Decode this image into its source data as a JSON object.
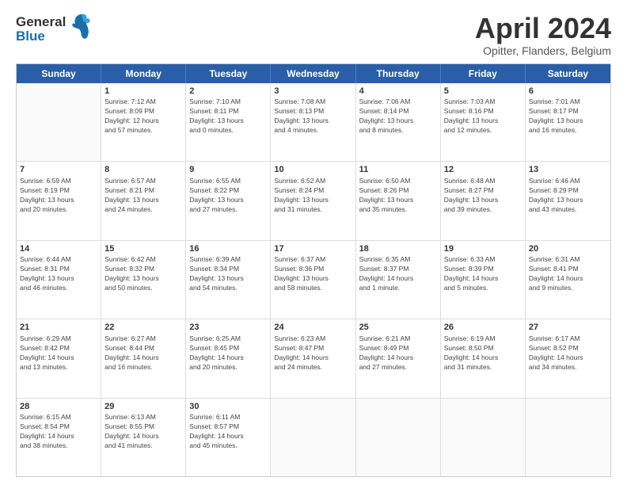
{
  "header": {
    "logo_general": "General",
    "logo_blue": "Blue",
    "month_title": "April 2024",
    "subtitle": "Opitter, Flanders, Belgium"
  },
  "weekdays": [
    "Sunday",
    "Monday",
    "Tuesday",
    "Wednesday",
    "Thursday",
    "Friday",
    "Saturday"
  ],
  "rows": [
    [
      {
        "day": "",
        "text": ""
      },
      {
        "day": "1",
        "text": "Sunrise: 7:12 AM\nSunset: 8:09 PM\nDaylight: 12 hours\nand 57 minutes."
      },
      {
        "day": "2",
        "text": "Sunrise: 7:10 AM\nSunset: 8:11 PM\nDaylight: 13 hours\nand 0 minutes."
      },
      {
        "day": "3",
        "text": "Sunrise: 7:08 AM\nSunset: 8:13 PM\nDaylight: 13 hours\nand 4 minutes."
      },
      {
        "day": "4",
        "text": "Sunrise: 7:06 AM\nSunset: 8:14 PM\nDaylight: 13 hours\nand 8 minutes."
      },
      {
        "day": "5",
        "text": "Sunrise: 7:03 AM\nSunset: 8:16 PM\nDaylight: 13 hours\nand 12 minutes."
      },
      {
        "day": "6",
        "text": "Sunrise: 7:01 AM\nSunset: 8:17 PM\nDaylight: 13 hours\nand 16 minutes."
      }
    ],
    [
      {
        "day": "7",
        "text": "Sunrise: 6:59 AM\nSunset: 8:19 PM\nDaylight: 13 hours\nand 20 minutes."
      },
      {
        "day": "8",
        "text": "Sunrise: 6:57 AM\nSunset: 8:21 PM\nDaylight: 13 hours\nand 24 minutes."
      },
      {
        "day": "9",
        "text": "Sunrise: 6:55 AM\nSunset: 8:22 PM\nDaylight: 13 hours\nand 27 minutes."
      },
      {
        "day": "10",
        "text": "Sunrise: 6:52 AM\nSunset: 8:24 PM\nDaylight: 13 hours\nand 31 minutes."
      },
      {
        "day": "11",
        "text": "Sunrise: 6:50 AM\nSunset: 8:26 PM\nDaylight: 13 hours\nand 35 minutes."
      },
      {
        "day": "12",
        "text": "Sunrise: 6:48 AM\nSunset: 8:27 PM\nDaylight: 13 hours\nand 39 minutes."
      },
      {
        "day": "13",
        "text": "Sunrise: 6:46 AM\nSunset: 8:29 PM\nDaylight: 13 hours\nand 43 minutes."
      }
    ],
    [
      {
        "day": "14",
        "text": "Sunrise: 6:44 AM\nSunset: 8:31 PM\nDaylight: 13 hours\nand 46 minutes."
      },
      {
        "day": "15",
        "text": "Sunrise: 6:42 AM\nSunset: 8:32 PM\nDaylight: 13 hours\nand 50 minutes."
      },
      {
        "day": "16",
        "text": "Sunrise: 6:39 AM\nSunset: 8:34 PM\nDaylight: 13 hours\nand 54 minutes."
      },
      {
        "day": "17",
        "text": "Sunrise: 6:37 AM\nSunset: 8:36 PM\nDaylight: 13 hours\nand 58 minutes."
      },
      {
        "day": "18",
        "text": "Sunrise: 6:35 AM\nSunset: 8:37 PM\nDaylight: 14 hours\nand 1 minute."
      },
      {
        "day": "19",
        "text": "Sunrise: 6:33 AM\nSunset: 8:39 PM\nDaylight: 14 hours\nand 5 minutes."
      },
      {
        "day": "20",
        "text": "Sunrise: 6:31 AM\nSunset: 8:41 PM\nDaylight: 14 hours\nand 9 minutes."
      }
    ],
    [
      {
        "day": "21",
        "text": "Sunrise: 6:29 AM\nSunset: 8:42 PM\nDaylight: 14 hours\nand 13 minutes."
      },
      {
        "day": "22",
        "text": "Sunrise: 6:27 AM\nSunset: 8:44 PM\nDaylight: 14 hours\nand 16 minutes."
      },
      {
        "day": "23",
        "text": "Sunrise: 6:25 AM\nSunset: 8:45 PM\nDaylight: 14 hours\nand 20 minutes."
      },
      {
        "day": "24",
        "text": "Sunrise: 6:23 AM\nSunset: 8:47 PM\nDaylight: 14 hours\nand 24 minutes."
      },
      {
        "day": "25",
        "text": "Sunrise: 6:21 AM\nSunset: 8:49 PM\nDaylight: 14 hours\nand 27 minutes."
      },
      {
        "day": "26",
        "text": "Sunrise: 6:19 AM\nSunset: 8:50 PM\nDaylight: 14 hours\nand 31 minutes."
      },
      {
        "day": "27",
        "text": "Sunrise: 6:17 AM\nSunset: 8:52 PM\nDaylight: 14 hours\nand 34 minutes."
      }
    ],
    [
      {
        "day": "28",
        "text": "Sunrise: 6:15 AM\nSunset: 8:54 PM\nDaylight: 14 hours\nand 38 minutes."
      },
      {
        "day": "29",
        "text": "Sunrise: 6:13 AM\nSunset: 8:55 PM\nDaylight: 14 hours\nand 41 minutes."
      },
      {
        "day": "30",
        "text": "Sunrise: 6:11 AM\nSunset: 8:57 PM\nDaylight: 14 hours\nand 45 minutes."
      },
      {
        "day": "",
        "text": ""
      },
      {
        "day": "",
        "text": ""
      },
      {
        "day": "",
        "text": ""
      },
      {
        "day": "",
        "text": ""
      }
    ]
  ]
}
